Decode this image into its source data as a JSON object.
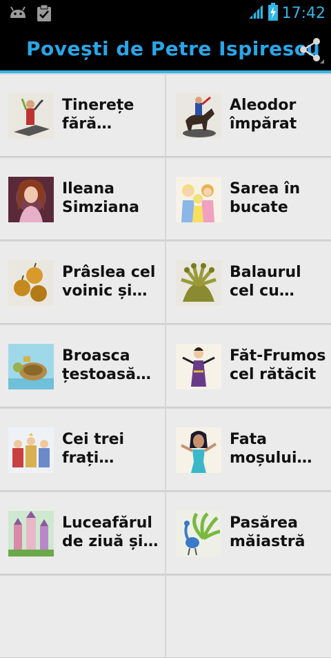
{
  "status_bar": {
    "time": "17:42",
    "icons": [
      "android-icon",
      "clipboard-check-icon",
      "signal-icon",
      "battery-charging-icon"
    ],
    "clock_color": "#33b5e5"
  },
  "action_bar": {
    "title": "Povești de Petre Ispirescu",
    "title_color": "#29a6e8",
    "share_icon": "share-icon",
    "underline_color": "#33b5e5"
  },
  "stories": [
    {
      "title": "Tinerețe fără bătrânețe și viață fără de moarte",
      "thumb": "warrior-statue"
    },
    {
      "title": "Aleodor împărat",
      "thumb": "horse-rider"
    },
    {
      "title": "Ileana Simziana",
      "thumb": "lady-portrait"
    },
    {
      "title": "Sarea în bucate",
      "thumb": "princesses"
    },
    {
      "title": "Prâslea cel voinic și merele de aur",
      "thumb": "golden-apples"
    },
    {
      "title": "Balaurul cel cu șapte capete",
      "thumb": "dragon"
    },
    {
      "title": "Broasca țestoasă cea fermecată",
      "thumb": "turtle"
    },
    {
      "title": "Făt-Frumos cel rătăcit",
      "thumb": "prince-cartoon"
    },
    {
      "title": "Cei trei frați împărați",
      "thumb": "three-brothers"
    },
    {
      "title": "Fata moșului cea cuminte",
      "thumb": "girl-cartoon"
    },
    {
      "title": "Luceafărul de ziuă și luceafărul de noapte",
      "thumb": "castle"
    },
    {
      "title": "Pasărea măiastră",
      "thumb": "peacock"
    }
  ]
}
